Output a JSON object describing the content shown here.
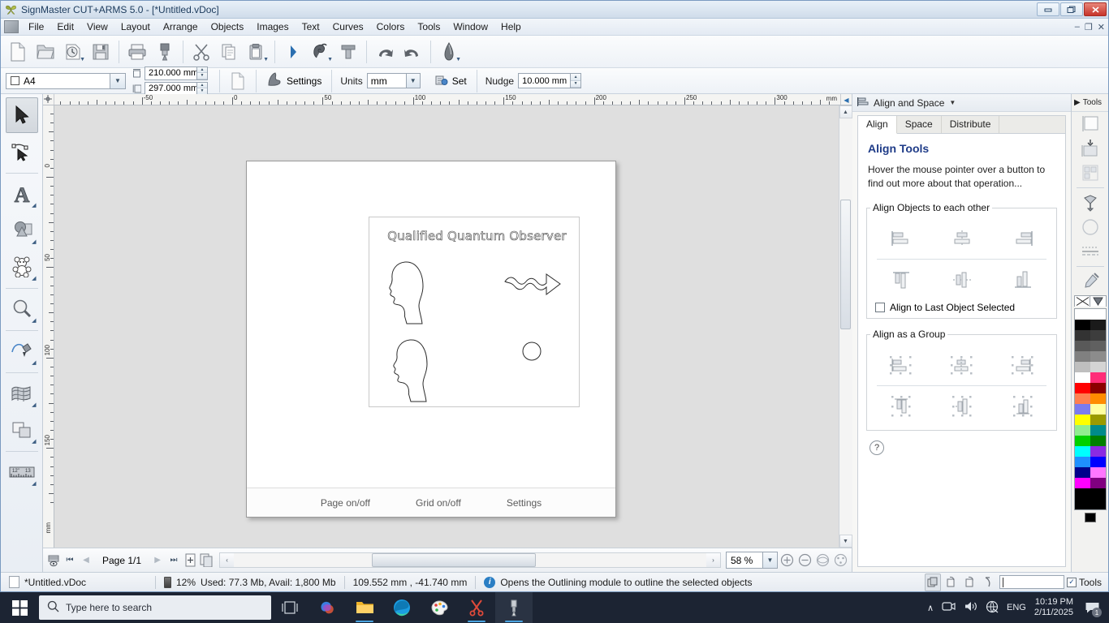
{
  "window": {
    "title": "SignMaster CUT+ARMS 5.0 - [*Untitled.vDoc]",
    "app_icon": "butterfly-icon",
    "minimize": "–",
    "maximize": "❐",
    "close": "✕",
    "doc_minimize": "–",
    "doc_restore": "❐",
    "doc_close": "✕"
  },
  "menu": {
    "items": [
      {
        "label": "File"
      },
      {
        "label": "Edit"
      },
      {
        "label": "View"
      },
      {
        "label": "Layout"
      },
      {
        "label": "Arrange"
      },
      {
        "label": "Objects"
      },
      {
        "label": "Images"
      },
      {
        "label": "Text"
      },
      {
        "label": "Curves"
      },
      {
        "label": "Colors"
      },
      {
        "label": "Tools"
      },
      {
        "label": "Window"
      },
      {
        "label": "Help"
      }
    ]
  },
  "toolbar_main": {
    "buttons": [
      {
        "name": "new-document-icon",
        "title": "New"
      },
      {
        "name": "open-document-icon",
        "title": "Open"
      },
      {
        "name": "recent-files-icon",
        "title": "Recent",
        "dropdown": true
      },
      {
        "name": "save-icon",
        "title": "Save"
      },
      {
        "name": "print-icon",
        "title": "Print"
      },
      {
        "name": "cut-plot-icon",
        "title": "Cut / Plot"
      },
      {
        "name": "scissors-cut-icon",
        "title": "Cut"
      },
      {
        "name": "copy-icon",
        "title": "Copy"
      },
      {
        "name": "paste-icon",
        "title": "Paste",
        "dropdown": true
      },
      {
        "name": "node-edit-icon",
        "title": "Node Edit"
      },
      {
        "name": "vectorize-icon",
        "title": "Vectorize",
        "dropdown": true
      },
      {
        "name": "outline-icon",
        "title": "Outline"
      },
      {
        "name": "undo-icon",
        "title": "Undo"
      },
      {
        "name": "redo-icon",
        "title": "Redo"
      },
      {
        "name": "weed-icon",
        "title": "Weed",
        "dropdown": true
      }
    ]
  },
  "toolbar_page": {
    "page_size": "A4",
    "width": "210.000 mm",
    "height": "297.000 mm",
    "page_setup_icon": "page-icon",
    "settings_label": "Settings",
    "units_label": "Units",
    "units_value": "mm",
    "set_label": "Set",
    "nudge_label": "Nudge",
    "nudge_value": "10.000 mm"
  },
  "left_tools": [
    {
      "name": "select-tool",
      "label": "Select",
      "active": true
    },
    {
      "name": "node-edit-tool",
      "label": "Node Edit"
    },
    {
      "name": "text-tool",
      "label": "Text"
    },
    {
      "name": "shape-tool",
      "label": "Shapes"
    },
    {
      "name": "clipart-tool",
      "label": "Clipart"
    },
    {
      "name": "zoom-tool",
      "label": "Zoom"
    },
    {
      "name": "draw-pen-tool",
      "label": "Draw / Pen"
    },
    {
      "name": "warp-tool",
      "label": "Warp / Envelope"
    },
    {
      "name": "weld-tool",
      "label": "Weld / Shaping"
    },
    {
      "name": "measure-tool",
      "label": "Measure"
    }
  ],
  "rulers": {
    "unit": "mm",
    "h_labels": [
      "00",
      "-50",
      "0",
      "50",
      "100",
      "150",
      "200",
      "250",
      "300"
    ],
    "v_labels": [
      "0",
      "50",
      "100",
      "150"
    ]
  },
  "canvas": {
    "design_title": "Qualified Quantum Observer",
    "footer": {
      "page_toggle": "Page on/off",
      "grid_toggle": "Grid on/off",
      "settings": "Settings"
    },
    "objects": [
      {
        "name": "head-silhouette-top",
        "type": "outline-path"
      },
      {
        "name": "head-silhouette-bottom",
        "type": "outline-path"
      },
      {
        "name": "arrow-shape",
        "type": "outline-path"
      },
      {
        "name": "circle-shape",
        "type": "outline-path"
      }
    ]
  },
  "canvas_bottom": {
    "page_preview_icon": "page-preview-icon",
    "first_page": "⏮",
    "prev_page": "◀",
    "page_label": "Page 1/1",
    "next_page": "▶",
    "last_page": "⏭",
    "add_page_icon": "add-page-icon",
    "duplicate_page_icon": "duplicate-page-icon",
    "scroll_left": "‹",
    "scroll_right": "›",
    "zoom_value": "58 %",
    "zoom_in": "+",
    "zoom_out": "–",
    "zoom_fit": "zoom-fit-icon",
    "zoom_all": "zoom-all-icon"
  },
  "right_panel": {
    "header_title": "Align and Space",
    "header_icon": "align-panel-icon",
    "header_dropdown": "▼",
    "tabs": [
      {
        "label": "Align",
        "active": true
      },
      {
        "label": "Space",
        "active": false
      },
      {
        "label": "Distribute",
        "active": false
      }
    ],
    "title": "Align Tools",
    "description": "Hover the mouse pointer over a button to find out more about that operation...",
    "group_objects": {
      "legend": "Align Objects to each other",
      "row1": [
        {
          "name": "align-left-button"
        },
        {
          "name": "align-center-horizontal-button"
        },
        {
          "name": "align-right-button"
        }
      ],
      "row2": [
        {
          "name": "align-top-button"
        },
        {
          "name": "align-middle-vertical-button"
        },
        {
          "name": "align-bottom-button"
        }
      ],
      "checkbox_label": "Align to Last Object Selected",
      "checkbox_checked": false
    },
    "group_as_group": {
      "legend": "Align as a Group",
      "row1": [
        {
          "name": "group-align-left-button"
        },
        {
          "name": "group-align-center-button"
        },
        {
          "name": "group-align-right-button"
        }
      ],
      "row2": [
        {
          "name": "group-align-top-button"
        },
        {
          "name": "group-align-middle-button"
        },
        {
          "name": "group-align-bottom-button"
        }
      ]
    },
    "help": "?"
  },
  "right_tools": {
    "header_label": "Tools",
    "header_icon": "chevron-right-icon",
    "buttons": [
      {
        "name": "fill-color-tool"
      },
      {
        "name": "fill-to-object-tool"
      },
      {
        "name": "pattern-fill-tool"
      },
      {
        "name": "paint-bucket-tool"
      },
      {
        "name": "outline-shape-tool"
      },
      {
        "name": "dash-line-tool"
      },
      {
        "name": "eyedropper-tool"
      }
    ],
    "no_fill_label": "no-fill-swatch",
    "palette_colors": [
      "#ffffff",
      "#ffffff",
      "#000000",
      "#1a1a1a",
      "#333333",
      "#3d3d3d",
      "#595959",
      "#606060",
      "#808080",
      "#8c8c8c",
      "#bfbfbf",
      "#d4d4d4",
      "#ffffff",
      "#ff2d78",
      "#ff0000",
      "#8b0000",
      "#ff7f50",
      "#ff8c00",
      "#7b7bf0",
      "#ffffa0",
      "#ffff00",
      "#9a9a00",
      "#90ee90",
      "#008b8b",
      "#00d000",
      "#008000",
      "#00ffff",
      "#8a2be2",
      "#1e90ff",
      "#0000ff",
      "#00008b",
      "#ff77ff",
      "#ff00ff",
      "#800080",
      "#000000",
      "#000000",
      "#000000",
      "#000000"
    ]
  },
  "statusbar": {
    "document": "*Untitled.vDoc",
    "memory_percent": "12%",
    "memory_text": "Used: 77.3 Mb, Avail: 1,800 Mb",
    "coordinates": "109.552 mm , -41.740 mm",
    "hint": "Opens the Outlining module to outline the selected objects",
    "right_buttons": [
      {
        "name": "snap-to-object-button"
      },
      {
        "name": "snap-to-grid-button"
      },
      {
        "name": "snap-to-guide-button"
      },
      {
        "name": "weed-lines-button"
      }
    ],
    "text_field_value": "",
    "tools_checkbox_label": "Tools",
    "tools_checkbox_checked": true
  },
  "taskbar": {
    "start_icon": "windows-start-icon",
    "search_placeholder": "Type here to search",
    "search_icon": "search-icon",
    "items": [
      {
        "name": "task-view-icon"
      },
      {
        "name": "copilot-icon"
      },
      {
        "name": "file-explorer-icon"
      },
      {
        "name": "edge-browser-icon"
      },
      {
        "name": "paint-icon"
      },
      {
        "name": "snipping-tool-icon"
      },
      {
        "name": "signmaster-icon",
        "active": true
      }
    ],
    "tray": {
      "chevron": "∧",
      "camera_icon": "camera-icon",
      "volume_icon": "volume-icon",
      "network_icon": "network-icon",
      "language": "ENG",
      "time": "10:19 PM",
      "date": "2/11/2025",
      "notification_icon": "notification-icon",
      "notification_count": "1"
    }
  }
}
